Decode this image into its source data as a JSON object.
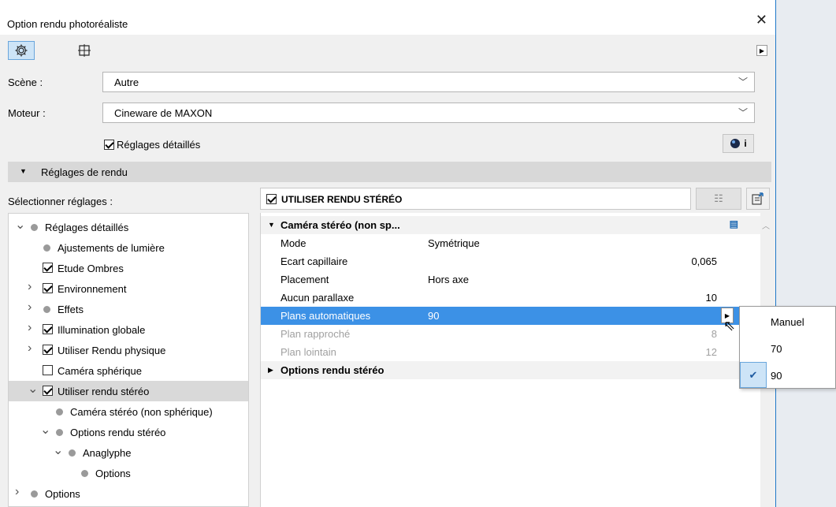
{
  "window": {
    "title": "Option rendu photoréaliste",
    "close": "✕"
  },
  "scene": {
    "label": "Scène :",
    "value": "Autre"
  },
  "moteur": {
    "label": "Moteur :",
    "value": "Cineware de MAXON"
  },
  "detailed": {
    "label": "Réglages détaillés",
    "checked": true
  },
  "info_button": "i",
  "section": {
    "title": "Réglages de rendu"
  },
  "select_label": "Sélectionner réglages :",
  "tree": [
    {
      "label": "Réglages détaillés",
      "kind": "dot",
      "arrow": "open",
      "level": 0
    },
    {
      "label": "Ajustements de lumière",
      "kind": "dot",
      "arrow": "none",
      "level": 1
    },
    {
      "label": "Etude Ombres",
      "kind": "check",
      "arrow": "none",
      "level": 1
    },
    {
      "label": "Environnement",
      "kind": "check",
      "arrow": "closed",
      "level": 1
    },
    {
      "label": "Effets",
      "kind": "dot",
      "arrow": "closed",
      "level": 1
    },
    {
      "label": "Illumination globale",
      "kind": "check",
      "arrow": "closed",
      "level": 1
    },
    {
      "label": "Utiliser Rendu physique",
      "kind": "check",
      "arrow": "closed",
      "level": 1
    },
    {
      "label": "Caméra sphérique",
      "kind": "uncheck",
      "arrow": "none",
      "level": 1
    },
    {
      "label": "Utiliser rendu stéréo",
      "kind": "check",
      "arrow": "open",
      "level": 1,
      "selected": true
    },
    {
      "label": "Caméra stéréo (non sphérique)",
      "kind": "dot",
      "arrow": "none",
      "level": 2
    },
    {
      "label": "Options rendu stéréo",
      "kind": "dot",
      "arrow": "open",
      "level": 2
    },
    {
      "label": "Anaglyphe",
      "kind": "dot",
      "arrow": "open",
      "level": 3
    },
    {
      "label": "Options",
      "kind": "dot",
      "arrow": "none",
      "level": 4
    },
    {
      "label": "Options",
      "kind": "dot",
      "arrow": "closed",
      "level": 0
    }
  ],
  "panel": {
    "header": "UTILISER RENDU STÉRÉO",
    "checked": true
  },
  "props": {
    "group1": "Caméra stéréo (non sp...",
    "rows": [
      {
        "name": "Mode",
        "value": "Symétrique",
        "num": ""
      },
      {
        "name": "Ecart capillaire",
        "value": "",
        "num": "0,065"
      },
      {
        "name": "Placement",
        "value": "Hors axe",
        "num": ""
      },
      {
        "name": "Aucun parallaxe",
        "value": "",
        "num": "10"
      },
      {
        "name": "Plans automatiques",
        "value": "90",
        "num": "",
        "highlight": true
      },
      {
        "name": "Plan rapproché",
        "value": "",
        "num": "8",
        "dim": true
      },
      {
        "name": "Plan lointain",
        "value": "",
        "num": "12",
        "dim": true
      }
    ],
    "group2": "Options rendu stéréo"
  },
  "popup": {
    "items": [
      {
        "label": "Manuel",
        "checked": false
      },
      {
        "label": "70",
        "checked": false
      },
      {
        "label": "90",
        "checked": true
      }
    ]
  }
}
